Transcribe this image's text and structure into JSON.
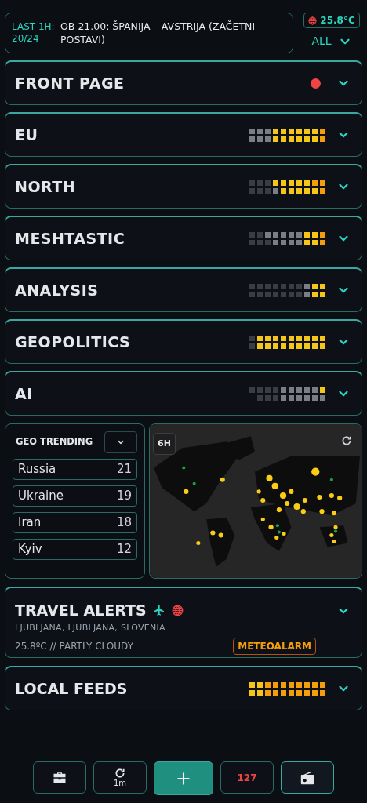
{
  "ticker": {
    "label": "LAST 1H:",
    "count": "20/24",
    "headline": "OB 21.00: ŠPANIJA – AVSTRIJA (ZAČETNI POSTAVI)"
  },
  "weather_badge": {
    "temp": "25.8°C"
  },
  "filter": {
    "label": "ALL"
  },
  "sections": [
    {
      "title": "FRONT PAGE",
      "kind": "alert",
      "expanded": false
    },
    {
      "title": "EU",
      "kind": "heat",
      "expanded": false
    },
    {
      "title": "NORTH",
      "kind": "heat",
      "expanded": false
    },
    {
      "title": "MESHTASTIC",
      "kind": "heat",
      "expanded": false
    },
    {
      "title": "ANALYSIS",
      "kind": "heat",
      "expanded": false
    },
    {
      "title": "GEOPOLITICS",
      "kind": "heat",
      "expanded": false
    },
    {
      "title": "AI",
      "kind": "heat",
      "expanded": false
    }
  ],
  "geo_trending": {
    "title": "GEO TRENDING",
    "items": [
      {
        "name": "Russia",
        "count": "21"
      },
      {
        "name": "Ukraine",
        "count": "19"
      },
      {
        "name": "Iran",
        "count": "18"
      },
      {
        "name": "Kyiv",
        "count": "12"
      }
    ]
  },
  "map": {
    "range": "6H"
  },
  "travel_alerts": {
    "title": "TRAVEL ALERTS",
    "location": "LJUBLJANA, LJUBLJANA, SLOVENIA",
    "weather": "25.8ºC // PARTLY CLOUDY",
    "badge": "METEOALARM",
    "expanded": false
  },
  "local_feeds": {
    "title": "LOCAL FEEDS",
    "expanded": false
  },
  "bottom_bar": {
    "refresh_interval": "1m",
    "count": "127",
    "radio_on": true
  }
}
